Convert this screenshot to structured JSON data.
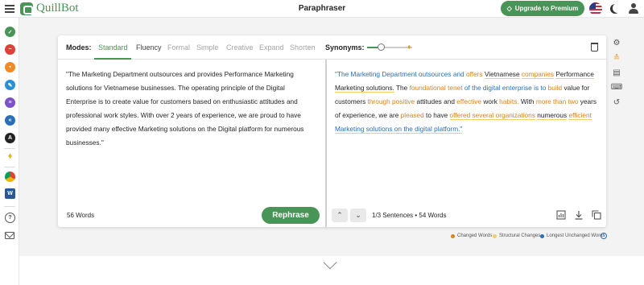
{
  "app": {
    "logo_text": "QuillBot",
    "page_title": "Paraphraser",
    "upgrade_label": "Upgrade to Premium",
    "brand_color": "#499557"
  },
  "sidebar": {
    "items": [
      {
        "icon": "grammar-checker-icon",
        "color": "#499557"
      },
      {
        "icon": "plagiarism-checker-icon",
        "color": "#e0403a"
      },
      {
        "icon": "ai-detector-icon",
        "color": "#f08a24"
      },
      {
        "icon": "paraphraser-tool-icon",
        "color": "#2b8fd6"
      },
      {
        "icon": "summarizer-icon",
        "color": "#7b52c9"
      },
      {
        "icon": "citation-generator-icon",
        "color": "#2b6fb6"
      },
      {
        "icon": "translator-icon",
        "color": "#222222"
      },
      {
        "icon": "premium-icon",
        "color": "#e8b422"
      },
      {
        "icon": "chrome-extension-icon",
        "color": "#4285f4"
      },
      {
        "icon": "word-extension-icon",
        "color": "#2b579a"
      },
      {
        "icon": "help-icon",
        "color": "#555555"
      },
      {
        "icon": "mail-icon",
        "color": "#555555"
      }
    ]
  },
  "modes": {
    "label": "Modes:",
    "items": [
      "Standard",
      "Fluency",
      "Formal",
      "Simple",
      "Creative",
      "Expand",
      "Shorten"
    ],
    "active": "Standard"
  },
  "synonyms": {
    "label": "Synonyms:",
    "level": 0.3
  },
  "input": {
    "text": "\"The Marketing Department outsources and provides Performance Marketing solutions for Vietnamese businesses. The operating principle of the Digital Enterprise is to create value for customers based on enthusiastic attitudes and professional work styles. With over 2 years of experience, we are proud to have provided many effective Marketing solutions on the Digital platform for numerous businesses.\"",
    "word_count": "56 Words",
    "rephrase_label": "Rephrase"
  },
  "output": {
    "segments": [
      {
        "t": "\"The Marketing Department outsources and ",
        "c": "lu"
      },
      {
        "t": "offers",
        "c": "ch"
      },
      {
        "t": " ",
        "c": ""
      },
      {
        "t": "Vietnamese",
        "c": "st"
      },
      {
        "t": " ",
        "c": ""
      },
      {
        "t": "companies",
        "c": "ch st"
      },
      {
        "t": " ",
        "c": ""
      },
      {
        "t": "Performance Marketing solutions.",
        "c": "st"
      },
      {
        "t": " The ",
        "c": ""
      },
      {
        "t": "foundational tenet",
        "c": "ch"
      },
      {
        "t": " ",
        "c": ""
      },
      {
        "t": "of the digital enterprise is to",
        "c": "lu"
      },
      {
        "t": " ",
        "c": ""
      },
      {
        "t": "build",
        "c": "ch"
      },
      {
        "t": " value for customers ",
        "c": ""
      },
      {
        "t": "through positive",
        "c": "ch"
      },
      {
        "t": " attitudes and ",
        "c": ""
      },
      {
        "t": "effective",
        "c": "ch"
      },
      {
        "t": " work ",
        "c": ""
      },
      {
        "t": "habits.",
        "c": "ch"
      },
      {
        "t": " With ",
        "c": ""
      },
      {
        "t": "more than two",
        "c": "ch"
      },
      {
        "t": " years of experience, we are ",
        "c": ""
      },
      {
        "t": "pleased",
        "c": "ch"
      },
      {
        "t": " to have ",
        "c": ""
      },
      {
        "t": "offered several organizations",
        "c": "ch st"
      },
      {
        "t": " ",
        "c": ""
      },
      {
        "t": "numerous",
        "c": "st"
      },
      {
        "t": " ",
        "c": ""
      },
      {
        "t": "efficient",
        "c": "ch st"
      },
      {
        "t": " ",
        "c": ""
      },
      {
        "t": "Marketing solutions on the digital platform.\"",
        "c": "lu st"
      }
    ],
    "sentences": "1/3 Sentences",
    "word_count": "54 Words"
  },
  "legend": {
    "changed": "Changed Words",
    "structural": "Structural Changes",
    "longest": "Longest Unchanged Words",
    "colors": {
      "changed": "#d9831f",
      "structural": "#f2cf65",
      "longest": "#2b6fb6"
    }
  }
}
